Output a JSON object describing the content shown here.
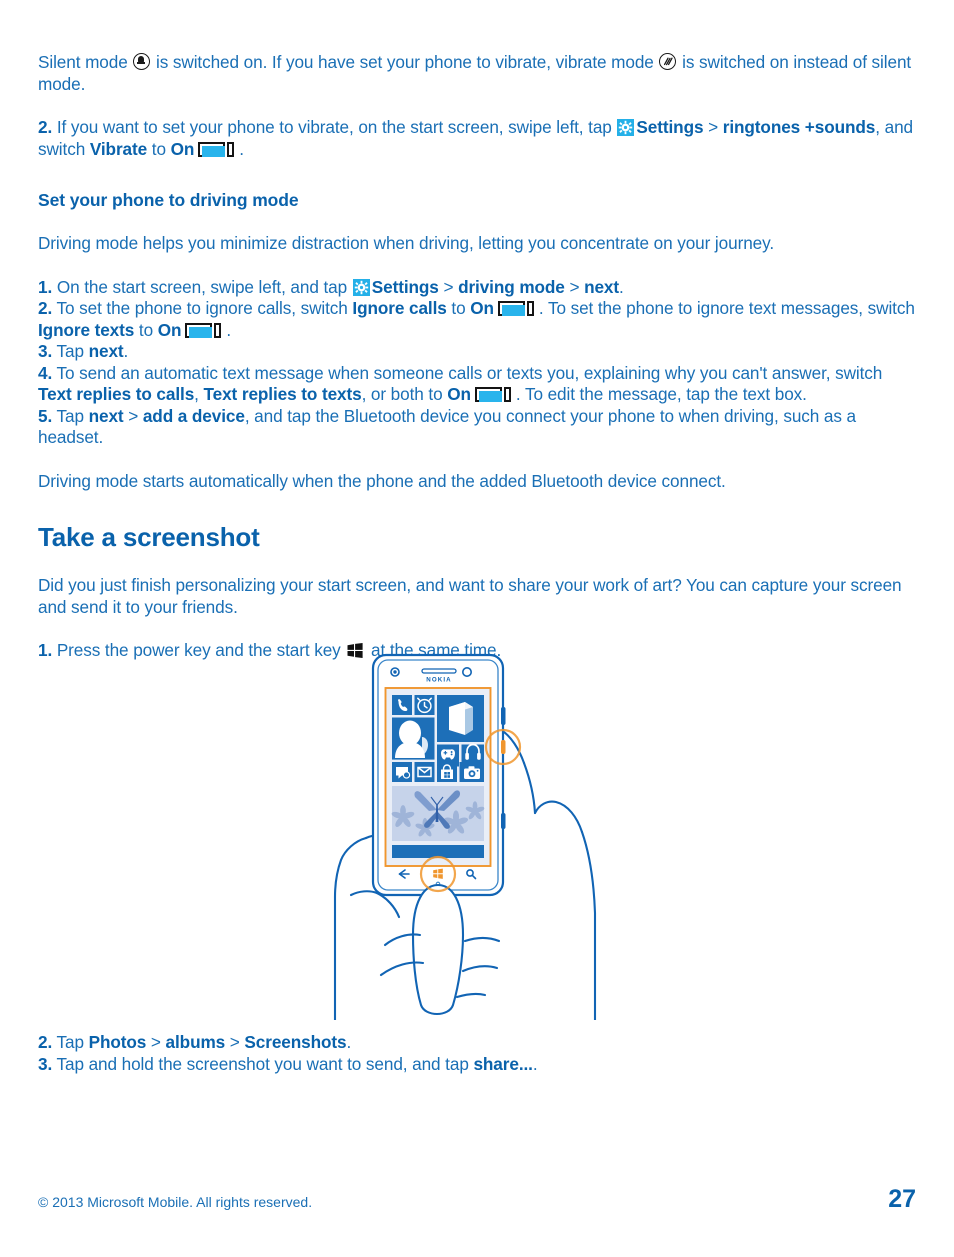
{
  "document": {
    "page_number": "27",
    "copyright": "© 2013 Microsoft Mobile. All rights reserved."
  },
  "colors": {
    "body_text": "#1a6fb5",
    "heading": "#0a62ab",
    "accent_cyan": "#24b0e8",
    "highlight_orange": "#f0962e",
    "illustration_blue": "#1164b4",
    "tile_blue": "#1d6fb8"
  },
  "intro": {
    "line1_a": "Silent mode ",
    "icon_silent": "bell-icon",
    "line1_b": " is switched on. If you have set your phone to vibrate, vibrate mode ",
    "icon_vibrate": "vibrate-icon",
    "line1_c": " is switched on instead of silent mode.",
    "step2_num": "2.",
    "step2_a": " If you want to set your phone to vibrate, on the start screen, swipe left, tap ",
    "step2_settings": "Settings",
    "step2_sep1": " > ",
    "step2_ringtones": "ringtones +sounds",
    "step2_b": ", and switch ",
    "step2_vibrate": "Vibrate",
    "step2_c": " to ",
    "step2_on": "On",
    "step2_d": "."
  },
  "driving": {
    "subhead": "Set your phone to driving mode",
    "intro": "Driving mode helps you minimize distraction when driving, letting you concentrate on your journey.",
    "step1_num": "1.",
    "step1_a": " On the start screen, swipe left, and tap ",
    "step1_settings": "Settings",
    "step1_sep1": " > ",
    "step1_drivingmode": "driving mode",
    "step1_sep2": " > ",
    "step1_next": "next",
    "step1_b": ".",
    "step2_num": "2.",
    "step2_a": " To set the phone to ignore calls, switch ",
    "step2_ignorecalls": "Ignore calls",
    "step2_b": " to ",
    "step2_on1": "On",
    "step2_c": ". To set the phone to ignore text messages, switch ",
    "step2_ignoretexts": "Ignore texts",
    "step2_d": " to ",
    "step2_on2": "On",
    "step2_e": ".",
    "step3_num": "3.",
    "step3_a": " Tap ",
    "step3_next": "next",
    "step3_b": ".",
    "step4_num": "4.",
    "step4_a": " To send an automatic text message when someone calls or texts you, explaining why you can't answer, switch ",
    "step4_textcalls": "Text replies to calls",
    "step4_b": ", ",
    "step4_texttexts": "Text replies to texts",
    "step4_c": ", or both to ",
    "step4_on": "On",
    "step4_d": ". To edit the message, tap the text box.",
    "step5_num": "5.",
    "step5_a": " Tap ",
    "step5_next": "next",
    "step5_sep": " > ",
    "step5_adddevice": "add a device",
    "step5_b": ", and tap the Bluetooth device you connect your phone to when driving, such as a headset.",
    "outro": "Driving mode starts automatically when the phone and the added Bluetooth device connect."
  },
  "screenshot_section": {
    "heading": "Take a screenshot",
    "intro": "Did you just finish personalizing your start screen, and want to share your work of art? You can capture your screen and send it to your friends.",
    "step1_num": "1.",
    "step1_a": " Press the power key and the start key ",
    "icon_startkey": "windows-start-key-icon",
    "step1_b": " at the same time.",
    "step2_num": "2.",
    "step2_a": " Tap ",
    "step2_photos": "Photos",
    "step2_sep1": " > ",
    "step2_albums": "albums",
    "step2_sep2": " > ",
    "step2_screenshots": "Screenshots",
    "step2_b": ".",
    "step3_num": "3.",
    "step3_a": " Tap and hold the screenshot you want to send, and tap ",
    "step3_share": "share...",
    "step3_b": "."
  },
  "illustration": {
    "name": "hand-holding-lumia-phone-taking-screenshot",
    "brand": "NOKIA",
    "tiles": [
      "phone-tile",
      "alarm-clock-tile",
      "office-tile",
      "people-tile",
      "xbox-games-tile",
      "music-headphones-tile",
      "messaging-tile",
      "email-tile",
      "store-tile",
      "camera-tile"
    ],
    "wallpaper_tile": "butterfly-flowers-photo-tile",
    "nav_buttons": [
      "back-button",
      "start-button",
      "search-button"
    ],
    "highlights": [
      "power-key-highlight-circle",
      "start-key-highlight-circle"
    ]
  }
}
